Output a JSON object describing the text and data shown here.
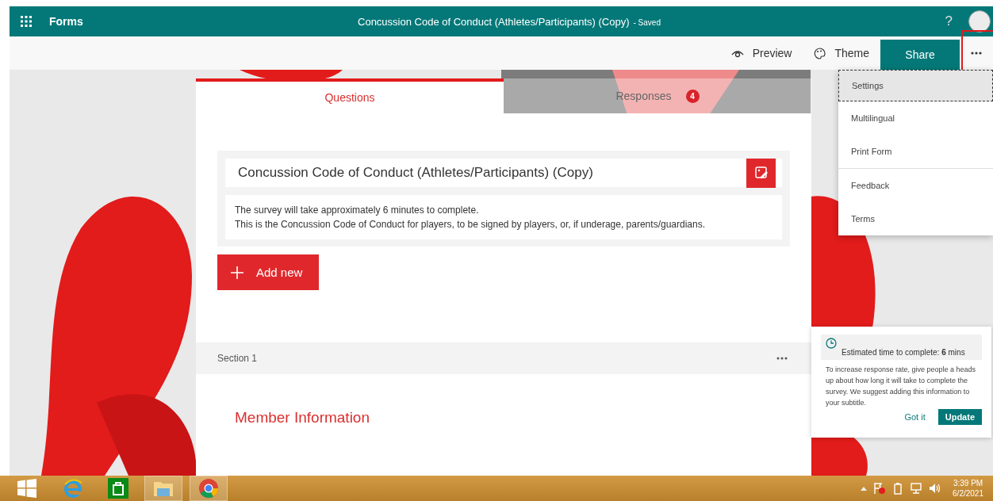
{
  "app_bar": {
    "app_name": "Forms",
    "title": "Concussion Code of Conduct (Athletes/Participants) (Copy)",
    "status": "- Saved",
    "help": "?"
  },
  "commands": [
    {
      "label": "Preview",
      "kind": "preview"
    },
    {
      "label": "Theme",
      "kind": "theme"
    }
  ],
  "share": "Share",
  "more_button": {
    "highlighted": true
  },
  "menu": [
    {
      "label": "Settings",
      "selected": true
    },
    {
      "label": "Multilingual",
      "selected": false
    },
    {
      "label": "Print Form",
      "selected": false
    },
    {
      "label": "Feedback",
      "selected": false
    },
    {
      "label": "Terms",
      "selected": false
    }
  ],
  "tabs": [
    {
      "label": "Questions",
      "selected": true
    },
    {
      "label": "Responses",
      "selected": false,
      "badge": "4"
    }
  ],
  "form": {
    "title": "Concussion Code of Conduct (Athletes/Participants) (Copy)",
    "description": [
      "The survey will take approximately 6 minutes to complete.",
      "This is the Concussion Code of Conduct for players, to be signed by players, or, if underage, parents/guardians."
    ]
  },
  "add_new": "Add new",
  "section": {
    "label": "Section 1",
    "heading": "Member Information"
  },
  "tip": {
    "heading": "Estimated time to complete: **6** mins",
    "body": "To increase response rate, give people a heads up about how long it will take to complete the survey. We suggest adding this information to your subtitle.",
    "dismiss": "Got it",
    "confirm": "Update"
  },
  "taskbar": {
    "apps": [
      {
        "kind": "ie",
        "open": false
      },
      {
        "kind": "store",
        "open": false
      },
      {
        "kind": "explorer",
        "open": true
      },
      {
        "kind": "chrome",
        "open": true
      }
    ],
    "time": "3:39 PM",
    "date": "6/2/2021"
  }
}
